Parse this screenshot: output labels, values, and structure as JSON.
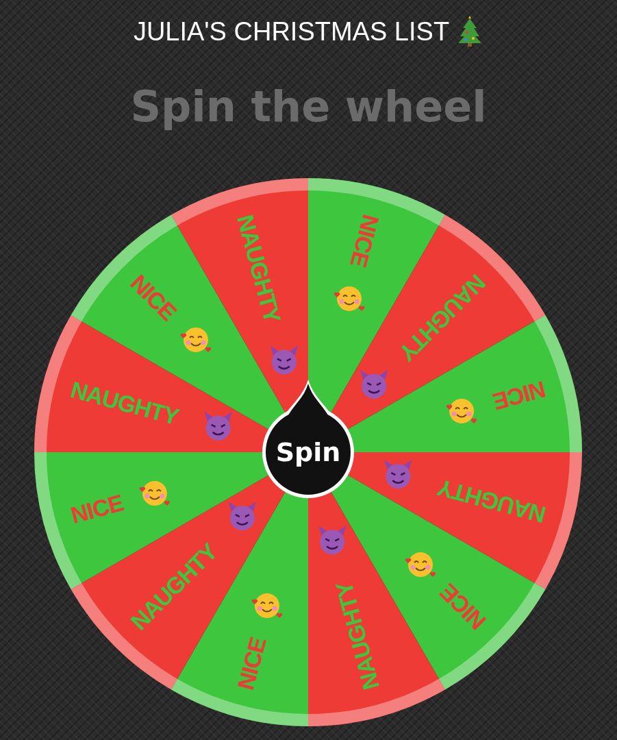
{
  "title": "JULIA'S CHRISTMAS LIST",
  "heading": "Spin the wheel",
  "wheel": {
    "segments": [
      {
        "label": "NICE",
        "kind": "nice",
        "color": "#3ec63e"
      },
      {
        "label": "NAUGHTY",
        "kind": "naughty",
        "color": "#ee3b36"
      },
      {
        "label": "NICE",
        "kind": "nice",
        "color": "#3ec63e"
      },
      {
        "label": "NAUGHTY",
        "kind": "naughty",
        "color": "#ee3b36"
      },
      {
        "label": "NICE",
        "kind": "nice",
        "color": "#3ec63e"
      },
      {
        "label": "NAUGHTY",
        "kind": "naughty",
        "color": "#ee3b36"
      },
      {
        "label": "NICE",
        "kind": "nice",
        "color": "#3ec63e"
      },
      {
        "label": "NAUGHTY",
        "kind": "naughty",
        "color": "#ee3b36"
      },
      {
        "label": "NICE",
        "kind": "nice",
        "color": "#3ec63e"
      },
      {
        "label": "NAUGHTY",
        "kind": "naughty",
        "color": "#ee3b36"
      },
      {
        "label": "NICE",
        "kind": "nice",
        "color": "#3ec63e"
      },
      {
        "label": "NAUGHTY",
        "kind": "naughty",
        "color": "#ee3b36"
      }
    ],
    "button": "Spin"
  }
}
